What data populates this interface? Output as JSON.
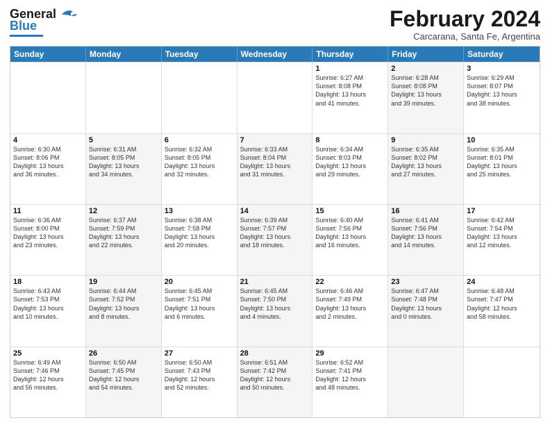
{
  "header": {
    "logo_line1": "General",
    "logo_line2": "Blue",
    "month_title": "February 2024",
    "location": "Carcarana, Santa Fe, Argentina"
  },
  "days_of_week": [
    "Sunday",
    "Monday",
    "Tuesday",
    "Wednesday",
    "Thursday",
    "Friday",
    "Saturday"
  ],
  "weeks": [
    [
      {
        "day": "",
        "text": "",
        "shaded": false
      },
      {
        "day": "",
        "text": "",
        "shaded": false
      },
      {
        "day": "",
        "text": "",
        "shaded": false
      },
      {
        "day": "",
        "text": "",
        "shaded": false
      },
      {
        "day": "1",
        "text": "Sunrise: 6:27 AM\nSunset: 8:08 PM\nDaylight: 13 hours\nand 41 minutes.",
        "shaded": false
      },
      {
        "day": "2",
        "text": "Sunrise: 6:28 AM\nSunset: 8:08 PM\nDaylight: 13 hours\nand 39 minutes.",
        "shaded": true
      },
      {
        "day": "3",
        "text": "Sunrise: 6:29 AM\nSunset: 8:07 PM\nDaylight: 13 hours\nand 38 minutes.",
        "shaded": false
      }
    ],
    [
      {
        "day": "4",
        "text": "Sunrise: 6:30 AM\nSunset: 8:06 PM\nDaylight: 13 hours\nand 36 minutes.",
        "shaded": false
      },
      {
        "day": "5",
        "text": "Sunrise: 6:31 AM\nSunset: 8:05 PM\nDaylight: 13 hours\nand 34 minutes.",
        "shaded": true
      },
      {
        "day": "6",
        "text": "Sunrise: 6:32 AM\nSunset: 8:05 PM\nDaylight: 13 hours\nand 32 minutes.",
        "shaded": false
      },
      {
        "day": "7",
        "text": "Sunrise: 6:33 AM\nSunset: 8:04 PM\nDaylight: 13 hours\nand 31 minutes.",
        "shaded": true
      },
      {
        "day": "8",
        "text": "Sunrise: 6:34 AM\nSunset: 8:03 PM\nDaylight: 13 hours\nand 29 minutes.",
        "shaded": false
      },
      {
        "day": "9",
        "text": "Sunrise: 6:35 AM\nSunset: 8:02 PM\nDaylight: 13 hours\nand 27 minutes.",
        "shaded": true
      },
      {
        "day": "10",
        "text": "Sunrise: 6:35 AM\nSunset: 8:01 PM\nDaylight: 13 hours\nand 25 minutes.",
        "shaded": false
      }
    ],
    [
      {
        "day": "11",
        "text": "Sunrise: 6:36 AM\nSunset: 8:00 PM\nDaylight: 13 hours\nand 23 minutes.",
        "shaded": false
      },
      {
        "day": "12",
        "text": "Sunrise: 6:37 AM\nSunset: 7:59 PM\nDaylight: 13 hours\nand 22 minutes.",
        "shaded": true
      },
      {
        "day": "13",
        "text": "Sunrise: 6:38 AM\nSunset: 7:58 PM\nDaylight: 13 hours\nand 20 minutes.",
        "shaded": false
      },
      {
        "day": "14",
        "text": "Sunrise: 6:39 AM\nSunset: 7:57 PM\nDaylight: 13 hours\nand 18 minutes.",
        "shaded": true
      },
      {
        "day": "15",
        "text": "Sunrise: 6:40 AM\nSunset: 7:56 PM\nDaylight: 13 hours\nand 16 minutes.",
        "shaded": false
      },
      {
        "day": "16",
        "text": "Sunrise: 6:41 AM\nSunset: 7:56 PM\nDaylight: 13 hours\nand 14 minutes.",
        "shaded": true
      },
      {
        "day": "17",
        "text": "Sunrise: 6:42 AM\nSunset: 7:54 PM\nDaylight: 13 hours\nand 12 minutes.",
        "shaded": false
      }
    ],
    [
      {
        "day": "18",
        "text": "Sunrise: 6:43 AM\nSunset: 7:53 PM\nDaylight: 13 hours\nand 10 minutes.",
        "shaded": false
      },
      {
        "day": "19",
        "text": "Sunrise: 6:44 AM\nSunset: 7:52 PM\nDaylight: 13 hours\nand 8 minutes.",
        "shaded": true
      },
      {
        "day": "20",
        "text": "Sunrise: 6:45 AM\nSunset: 7:51 PM\nDaylight: 13 hours\nand 6 minutes.",
        "shaded": false
      },
      {
        "day": "21",
        "text": "Sunrise: 6:45 AM\nSunset: 7:50 PM\nDaylight: 13 hours\nand 4 minutes.",
        "shaded": true
      },
      {
        "day": "22",
        "text": "Sunrise: 6:46 AM\nSunset: 7:49 PM\nDaylight: 13 hours\nand 2 minutes.",
        "shaded": false
      },
      {
        "day": "23",
        "text": "Sunrise: 6:47 AM\nSunset: 7:48 PM\nDaylight: 13 hours\nand 0 minutes.",
        "shaded": true
      },
      {
        "day": "24",
        "text": "Sunrise: 6:48 AM\nSunset: 7:47 PM\nDaylight: 12 hours\nand 58 minutes.",
        "shaded": false
      }
    ],
    [
      {
        "day": "25",
        "text": "Sunrise: 6:49 AM\nSunset: 7:46 PM\nDaylight: 12 hours\nand 56 minutes.",
        "shaded": false
      },
      {
        "day": "26",
        "text": "Sunrise: 6:50 AM\nSunset: 7:45 PM\nDaylight: 12 hours\nand 54 minutes.",
        "shaded": true
      },
      {
        "day": "27",
        "text": "Sunrise: 6:50 AM\nSunset: 7:43 PM\nDaylight: 12 hours\nand 52 minutes.",
        "shaded": false
      },
      {
        "day": "28",
        "text": "Sunrise: 6:51 AM\nSunset: 7:42 PM\nDaylight: 12 hours\nand 50 minutes.",
        "shaded": true
      },
      {
        "day": "29",
        "text": "Sunrise: 6:52 AM\nSunset: 7:41 PM\nDaylight: 12 hours\nand 48 minutes.",
        "shaded": false
      },
      {
        "day": "",
        "text": "",
        "shaded": true
      },
      {
        "day": "",
        "text": "",
        "shaded": false
      }
    ]
  ]
}
